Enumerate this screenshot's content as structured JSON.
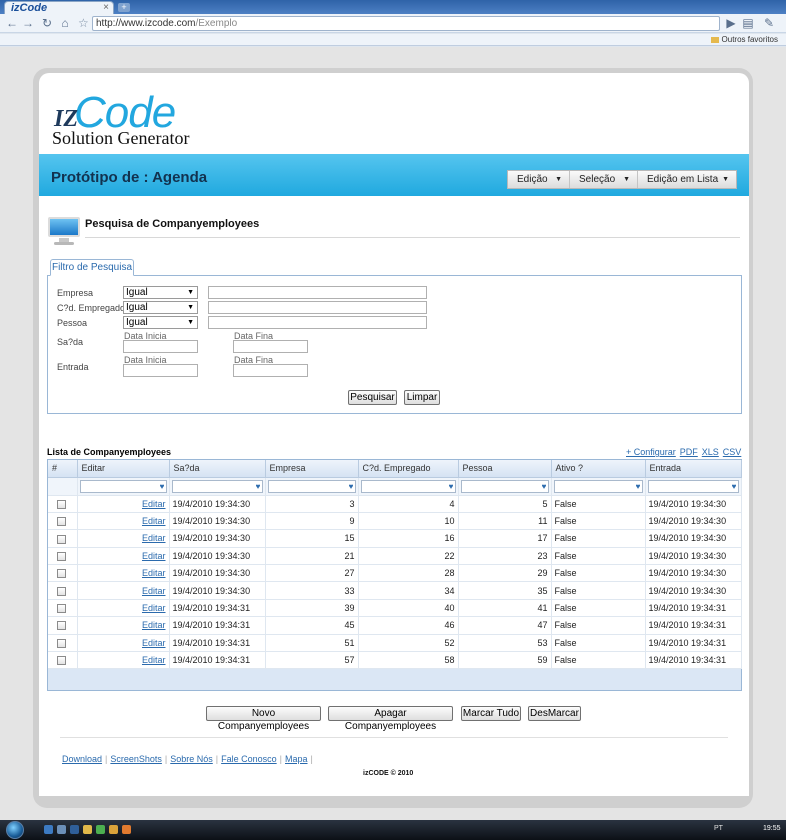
{
  "browser": {
    "tab_title": "izCode",
    "tab_close": "×",
    "new_tab": "+",
    "url_host": "http://www.izcode.com",
    "url_path": "/Exemplo",
    "other_bookmarks": "Outros favoritos"
  },
  "logo": {
    "iz": "IZ",
    "code": "Code",
    "subtitle": "Solution Generator"
  },
  "header": {
    "title": "Protótipo de : Agenda",
    "menu": [
      "Edição",
      "Seleção",
      "Edição em Lista"
    ]
  },
  "section": {
    "title": "Pesquisa de Companyemployees"
  },
  "filter": {
    "tab_label": "Filtro de Pesquisa",
    "fields": [
      {
        "label": "Empresa",
        "operator": "Igual"
      },
      {
        "label": "C?d. Empregado",
        "operator": "Igual"
      },
      {
        "label": "Pessoa",
        "operator": "Igual"
      }
    ],
    "saida_label": "Sa?da",
    "entrada_label": "Entrada",
    "date_start_label": "Data Inicia",
    "date_end_label": "Data Fina",
    "search_button": "Pesquisar",
    "clear_button": "Limpar"
  },
  "list": {
    "title": "Lista de Companyemployees",
    "links": [
      "+ Configurar",
      "PDF",
      "XLS",
      "CSV"
    ],
    "columns": [
      "#",
      "Editar",
      "Sa?da",
      "Empresa",
      "C?d. Empregado",
      "Pessoa",
      "Ativo ?",
      "Entrada"
    ],
    "rows": [
      {
        "edit": "Editar",
        "saida": "19/4/2010 19:34:30",
        "empresa": "3",
        "cod": "4",
        "pessoa": "5",
        "ativo": "False",
        "entrada": "19/4/2010 19:34:30"
      },
      {
        "edit": "Editar",
        "saida": "19/4/2010 19:34:30",
        "empresa": "9",
        "cod": "10",
        "pessoa": "11",
        "ativo": "False",
        "entrada": "19/4/2010 19:34:30"
      },
      {
        "edit": "Editar",
        "saida": "19/4/2010 19:34:30",
        "empresa": "15",
        "cod": "16",
        "pessoa": "17",
        "ativo": "False",
        "entrada": "19/4/2010 19:34:30"
      },
      {
        "edit": "Editar",
        "saida": "19/4/2010 19:34:30",
        "empresa": "21",
        "cod": "22",
        "pessoa": "23",
        "ativo": "False",
        "entrada": "19/4/2010 19:34:30"
      },
      {
        "edit": "Editar",
        "saida": "19/4/2010 19:34:30",
        "empresa": "27",
        "cod": "28",
        "pessoa": "29",
        "ativo": "False",
        "entrada": "19/4/2010 19:34:30"
      },
      {
        "edit": "Editar",
        "saida": "19/4/2010 19:34:30",
        "empresa": "33",
        "cod": "34",
        "pessoa": "35",
        "ativo": "False",
        "entrada": "19/4/2010 19:34:30"
      },
      {
        "edit": "Editar",
        "saida": "19/4/2010 19:34:31",
        "empresa": "39",
        "cod": "40",
        "pessoa": "41",
        "ativo": "False",
        "entrada": "19/4/2010 19:34:31"
      },
      {
        "edit": "Editar",
        "saida": "19/4/2010 19:34:31",
        "empresa": "45",
        "cod": "46",
        "pessoa": "47",
        "ativo": "False",
        "entrada": "19/4/2010 19:34:31"
      },
      {
        "edit": "Editar",
        "saida": "19/4/2010 19:34:31",
        "empresa": "51",
        "cod": "52",
        "pessoa": "53",
        "ativo": "False",
        "entrada": "19/4/2010 19:34:31"
      },
      {
        "edit": "Editar",
        "saida": "19/4/2010 19:34:31",
        "empresa": "57",
        "cod": "58",
        "pessoa": "59",
        "ativo": "False",
        "entrada": "19/4/2010 19:34:31"
      }
    ]
  },
  "actions": [
    "Novo Companyemployees",
    "Apagar Companyemployees",
    "Marcar Tudo",
    "DesMarcar"
  ],
  "footer": {
    "links": [
      "Download",
      "ScreenShots",
      "Sobre Nós",
      "Fale Conosco",
      "Mapa"
    ],
    "copyright": "izCODE © 2010"
  },
  "taskbar": {
    "language": "PT",
    "clock": "19:55"
  },
  "colors": {
    "accent": "#22a7df",
    "link": "#2a6aad",
    "banner_text": "#12324f"
  },
  "icons": [
    "back-icon",
    "forward-icon",
    "reload-icon",
    "home-icon",
    "star-icon",
    "page-menu-icon",
    "wrench-icon",
    "folder-icon",
    "monitor-icon",
    "filter-icon",
    "checkbox-icon",
    "start-orb-icon"
  ]
}
